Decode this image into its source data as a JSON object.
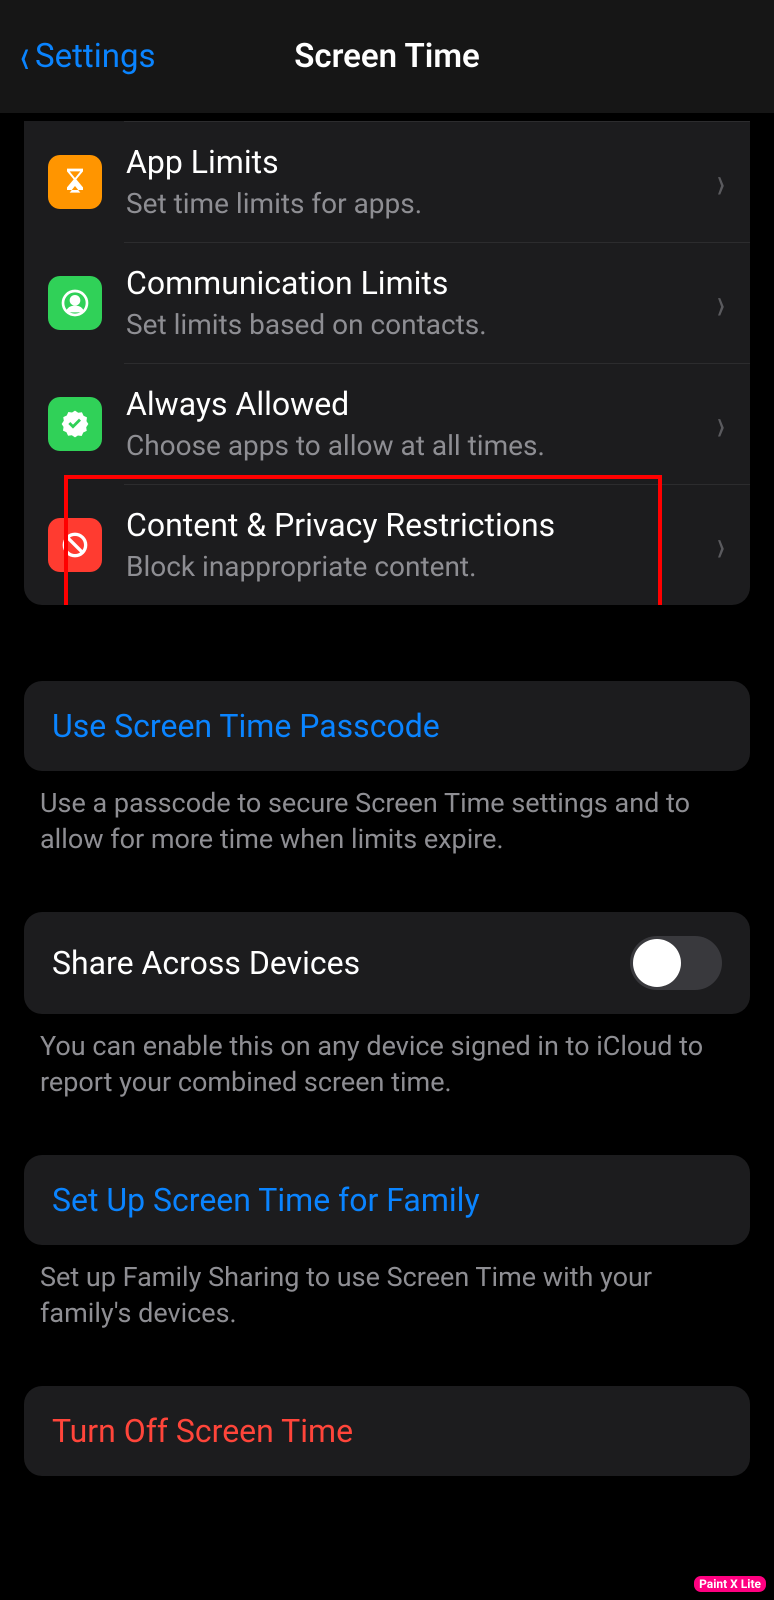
{
  "nav": {
    "back_label": "Settings",
    "title": "Screen Time"
  },
  "rows": {
    "app_limits": {
      "title": "App Limits",
      "subtitle": "Set time limits for apps."
    },
    "communication_limits": {
      "title": "Communication Limits",
      "subtitle": "Set limits based on contacts."
    },
    "always_allowed": {
      "title": "Always Allowed",
      "subtitle": "Choose apps to allow at all times."
    },
    "content_privacy": {
      "title": "Content & Privacy Restrictions",
      "subtitle": "Block inappropriate content."
    }
  },
  "passcode": {
    "action": "Use Screen Time Passcode",
    "footer": "Use a passcode to secure Screen Time settings and to allow for more time when limits expire."
  },
  "share": {
    "label": "Share Across Devices",
    "footer": "You can enable this on any device signed in to iCloud to report your combined screen time."
  },
  "family": {
    "action": "Set Up Screen Time for Family",
    "footer": "Set up Family Sharing to use Screen Time with your family's devices."
  },
  "turnoff": {
    "action": "Turn Off Screen Time"
  },
  "watermark": "Paint X Lite"
}
